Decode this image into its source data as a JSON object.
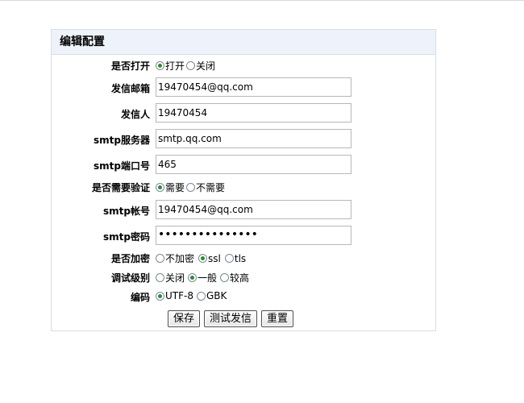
{
  "panel": {
    "title": "编辑配置"
  },
  "form": {
    "enable": {
      "label": "是否打开",
      "options": [
        "打开",
        "关闭"
      ],
      "selected": 0
    },
    "sender_email": {
      "label": "发信邮箱",
      "value": "19470454@qq.com"
    },
    "sender_name": {
      "label": "发信人",
      "value": "19470454"
    },
    "smtp_server": {
      "label": "smtp服务器",
      "value": "smtp.qq.com"
    },
    "smtp_port": {
      "label": "smtp端口号",
      "value": "465"
    },
    "auth_required": {
      "label": "是否需要验证",
      "options": [
        "需要",
        "不需要"
      ],
      "selected": 0
    },
    "smtp_account": {
      "label": "smtp帐号",
      "value": "19470454@qq.com"
    },
    "smtp_password": {
      "label": "smtp密码",
      "value": "•••••••••••••••"
    },
    "encryption": {
      "label": "是否加密",
      "options": [
        "不加密",
        "ssl",
        "tls"
      ],
      "selected": 1
    },
    "debug_level": {
      "label": "调试级别",
      "options": [
        "关闭",
        "一般",
        "较高"
      ],
      "selected": 1
    },
    "charset": {
      "label": "编码",
      "options": [
        "UTF-8",
        "GBK"
      ],
      "selected": 0
    }
  },
  "buttons": {
    "save": "保存",
    "test_send": "测试发信",
    "reset": "重置"
  },
  "colors": {
    "header_bg": "#eef3fb",
    "border": "#d7dde5",
    "radio_dot": "#2f8a2f"
  }
}
